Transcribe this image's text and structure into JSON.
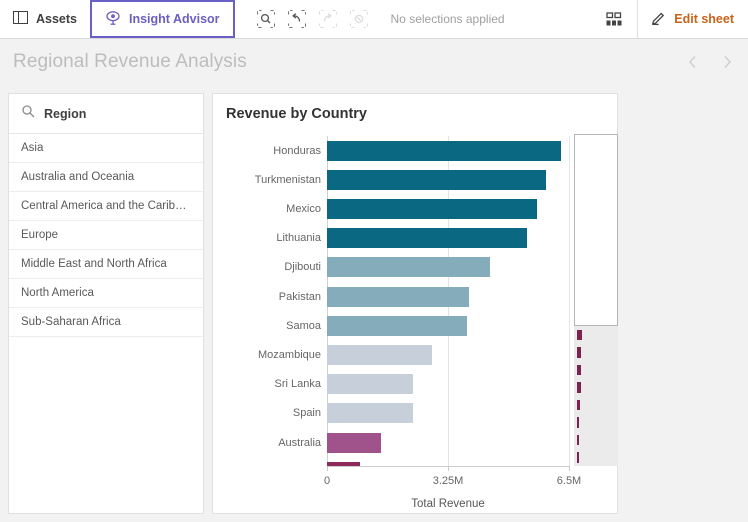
{
  "toolbar": {
    "assets_label": "Assets",
    "insight_advisor_label": "Insight Advisor",
    "selection_status": "No selections applied",
    "edit_sheet_label": "Edit sheet",
    "icons": {
      "assets": "panel-icon",
      "insight_advisor": "insight-eye-icon",
      "search": "selection-search-icon",
      "back": "selection-back-icon",
      "forward": "selection-forward-icon",
      "clear": "selection-clear-icon",
      "sheets": "sheet-grid-icon",
      "edit": "pencil-icon"
    },
    "accent_purple": "#6a5fc4",
    "edit_orange": "#c8631b"
  },
  "sheet": {
    "title": "Regional Revenue Analysis",
    "prev_label": "‹",
    "next_label": "›"
  },
  "filter_pane": {
    "title": "Region",
    "search_icon": "magnifier-icon",
    "items": [
      {
        "label": "Asia"
      },
      {
        "label": "Australia and Oceania"
      },
      {
        "label": "Central America and the Carib…"
      },
      {
        "label": "Europe"
      },
      {
        "label": "Middle East and North Africa"
      },
      {
        "label": "North America"
      },
      {
        "label": "Sub-Saharan Africa"
      }
    ]
  },
  "chart_data": {
    "type": "bar",
    "orientation": "horizontal",
    "title": "Revenue by Country",
    "xlabel": "Total Revenue",
    "ylabel": "",
    "xlim": [
      0,
      6500000
    ],
    "xticks": [
      0,
      3250000,
      6500000
    ],
    "xtick_labels": [
      "0",
      "3.25M",
      "6.5M"
    ],
    "grid": true,
    "legend": "none",
    "categories": [
      "Honduras",
      "Turkmenistan",
      "Mexico",
      "Lithuania",
      "Djibouti",
      "Pakistan",
      "Samoa",
      "Mozambique",
      "Sri Lanka",
      "Spain",
      "Australia"
    ],
    "values": [
      6280000,
      5870000,
      5640000,
      5370000,
      4370000,
      3820000,
      3760000,
      2830000,
      2320000,
      2310000,
      1440000
    ],
    "colors": [
      "#0a6883",
      "#0a6883",
      "#0a6883",
      "#0a6883",
      "#85acbb",
      "#85acbb",
      "#85acbb",
      "#c7cfdb",
      "#c7cfdb",
      "#c7cfdb",
      "#a0538a"
    ],
    "partial_row": {
      "value": 890000,
      "color": "#8e2a5c"
    },
    "scroll": {
      "total_bars": 19,
      "visible_bars": 11,
      "minimap_values": [
        6280000,
        5870000,
        5640000,
        5370000,
        4370000,
        3820000,
        3760000,
        2830000,
        2320000,
        2310000,
        1440000,
        890000,
        650000,
        700000,
        690000,
        560000,
        430000,
        400000,
        210000
      ],
      "minimap_colors": [
        "#0a6883",
        "#0a6883",
        "#0a6883",
        "#0a6883",
        "#85acbb",
        "#85acbb",
        "#85acbb",
        "#c7cfdb",
        "#c7cfdb",
        "#c7cfdb",
        "#a0538a",
        "#7b2250",
        "#7b2250",
        "#7b2250",
        "#7b2250",
        "#7b2250",
        "#7b2250",
        "#7b2250",
        "#7b2250"
      ]
    }
  }
}
